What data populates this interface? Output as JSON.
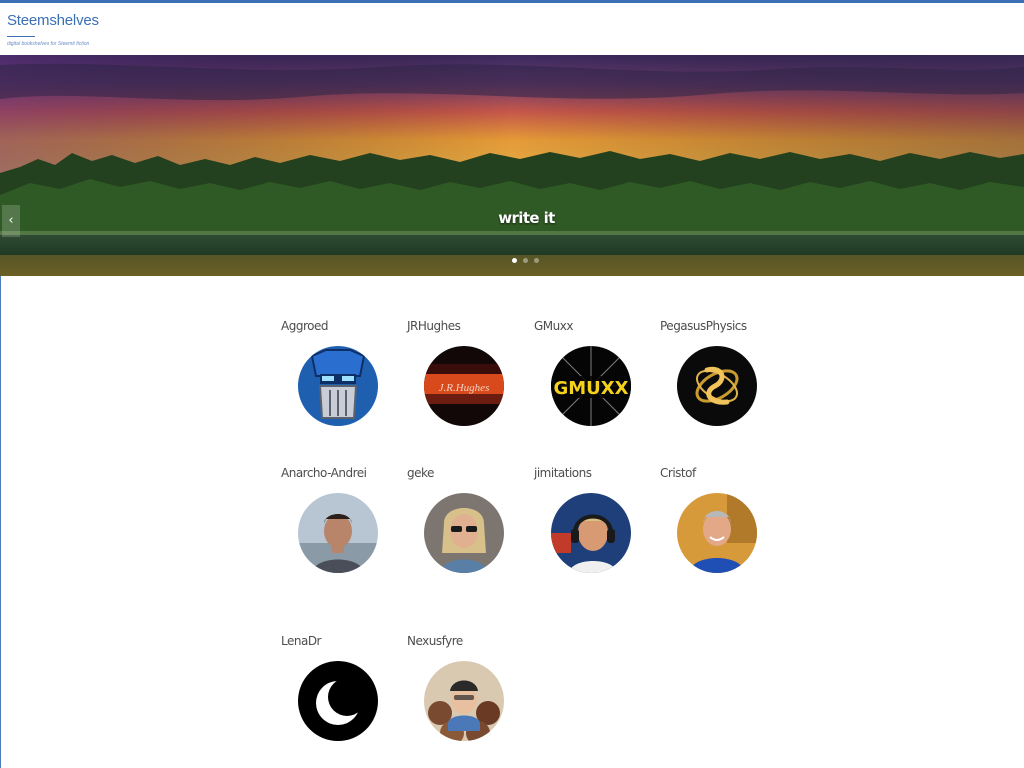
{
  "site": {
    "title": "Steemshelves",
    "tagline": "digital bookshelves for Steemit fiction",
    "accent_color": "#3b6fb6"
  },
  "hero": {
    "caption": "write it",
    "prev_icon_glyph": "‹",
    "slide_count": 3,
    "active_slide": 1
  },
  "authors": [
    {
      "name": "Aggroed",
      "avatar": "robot-mask-avatar"
    },
    {
      "name": "JRHughes",
      "avatar": "sunset-signature-avatar",
      "avatar_text": "J.R.Hughes"
    },
    {
      "name": "GMuxx",
      "avatar": "gmuxx-logo-avatar",
      "avatar_text": "GMUXX"
    },
    {
      "name": "PegasusPhysics",
      "avatar": "gold-emblem-avatar"
    },
    {
      "name": "Anarcho-Andrei",
      "avatar": "man-outdoor-photo-avatar"
    },
    {
      "name": "geke",
      "avatar": "woman-sunglasses-photo-avatar"
    },
    {
      "name": "jimitations",
      "avatar": "man-headphones-photo-avatar"
    },
    {
      "name": "Cristof",
      "avatar": "man-smiling-photo-avatar"
    },
    {
      "name": "LenaDr",
      "avatar": "crescent-moon-avatar"
    },
    {
      "name": "Nexusfyre",
      "avatar": "group-photo-avatar"
    }
  ]
}
